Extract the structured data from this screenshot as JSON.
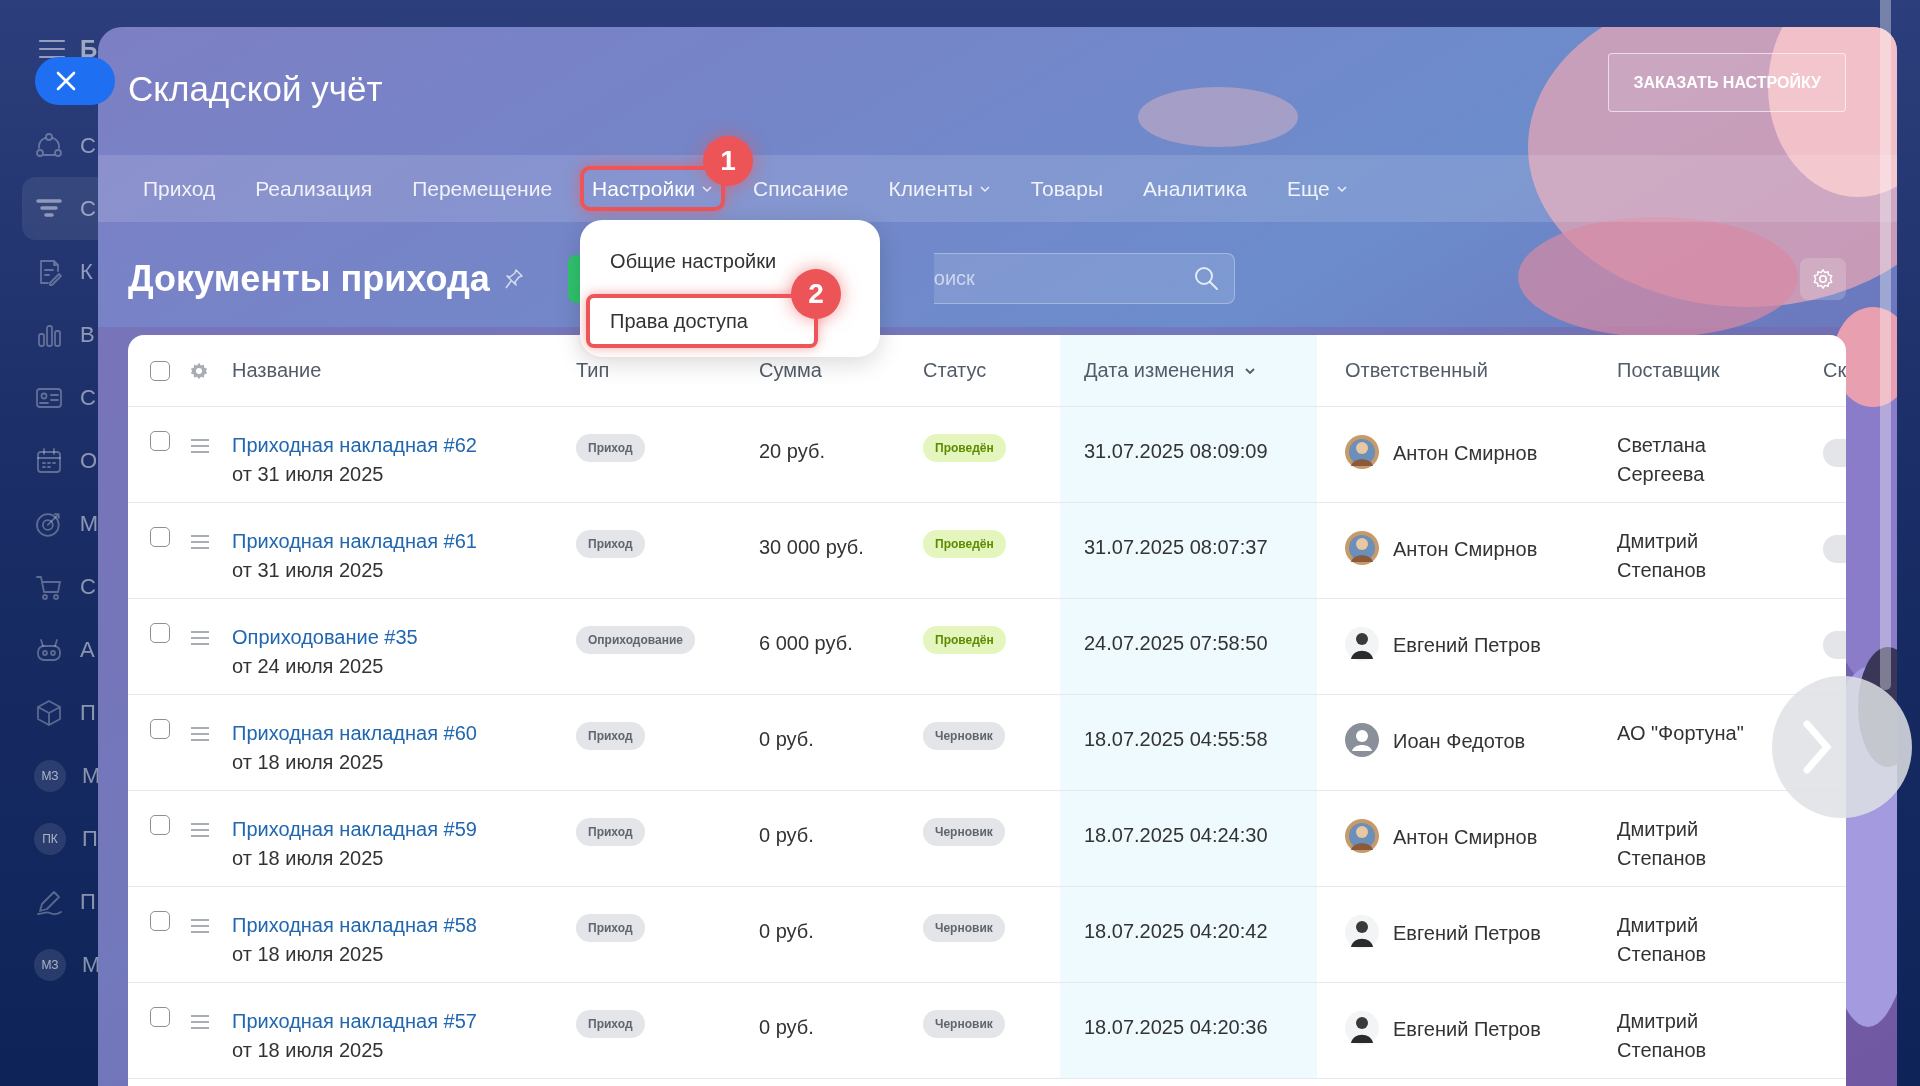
{
  "sidebar": {
    "title_letter": "Б",
    "items": [
      {
        "label": "С",
        "kind": "icon",
        "selected": false
      },
      {
        "label": "С",
        "kind": "icon",
        "selected": true
      },
      {
        "label": "К",
        "kind": "icon",
        "selected": false
      },
      {
        "label": "В",
        "kind": "icon",
        "selected": false
      },
      {
        "label": "С",
        "kind": "icon",
        "selected": false
      },
      {
        "label": "О",
        "kind": "icon",
        "selected": false
      },
      {
        "label": "М",
        "kind": "icon",
        "selected": false
      },
      {
        "label": "С",
        "kind": "icon",
        "selected": false
      },
      {
        "label": "А",
        "kind": "icon",
        "selected": false
      },
      {
        "label": "П",
        "kind": "icon",
        "selected": false
      },
      {
        "label": "М",
        "kind": "badge",
        "badge": "МЗ",
        "selected": false
      },
      {
        "label": "П",
        "kind": "badge",
        "badge": "ПК",
        "selected": false
      },
      {
        "label": "П",
        "kind": "icon",
        "selected": false
      },
      {
        "label": "М",
        "kind": "badge",
        "badge": "МЗ",
        "selected": false
      }
    ]
  },
  "panel": {
    "title": "Складской учёт",
    "order_button": "ЗАКАЗАТЬ НАСТРОЙКУ"
  },
  "tabs": [
    {
      "label": "Приход",
      "has_menu": false,
      "expanded": false
    },
    {
      "label": "Реализация",
      "has_menu": false,
      "expanded": false
    },
    {
      "label": "Перемещение",
      "has_menu": false,
      "expanded": false
    },
    {
      "label": "Настройки",
      "has_menu": true,
      "callout": "1",
      "expanded": true
    },
    {
      "label": "Списание",
      "has_menu": false,
      "expanded": false
    },
    {
      "label": "Клиенты",
      "has_menu": true,
      "expanded": false
    },
    {
      "label": "Товары",
      "has_menu": false,
      "expanded": false
    },
    {
      "label": "Аналитика",
      "has_menu": false,
      "expanded": false
    },
    {
      "label": "Еще",
      "has_menu": true,
      "expanded": false
    }
  ],
  "dropdown": {
    "items": [
      {
        "label": "Общие настройки"
      },
      {
        "label": "Права доступа",
        "callout": "2"
      }
    ]
  },
  "page": {
    "heading": "Документы прихода",
    "search": {
      "placeholder": "оиск"
    }
  },
  "table": {
    "all_checked": false,
    "columns": [
      {
        "label": "Название",
        "sorted": false
      },
      {
        "label": "Тип",
        "sorted": false
      },
      {
        "label": "Сумма",
        "sorted": false
      },
      {
        "label": "Статус",
        "sorted": false
      },
      {
        "label": "Дата изменения",
        "sorted": true
      },
      {
        "label": "Ответственный",
        "sorted": false
      },
      {
        "label": "Поставщик",
        "sorted": false
      },
      {
        "label": "Ск",
        "sorted": false
      }
    ],
    "rows": [
      {
        "checked": false,
        "title": "Приходная накладная #62",
        "date": "от 31 июля 2025",
        "type": "Приход",
        "sum": "20 руб.",
        "status": {
          "text": "Проведён",
          "kind": "posted"
        },
        "changed": "31.07.2025 08:09:09",
        "responsible": "Антон Смирнов",
        "supplier": "Светлана Сергеева",
        "extra_tag": true
      },
      {
        "checked": false,
        "title": "Приходная накладная #61",
        "date": "от 31 июля 2025",
        "type": "Приход",
        "sum": "30 000 руб.",
        "status": {
          "text": "Проведён",
          "kind": "posted"
        },
        "changed": "31.07.2025 08:07:37",
        "responsible": "Антон Смирнов",
        "supplier": "Дмитрий Степанов",
        "extra_tag": true
      },
      {
        "checked": false,
        "title": "Оприходование #35",
        "date": "от 24 июля 2025",
        "type": "Оприходование",
        "sum": "6 000 руб.",
        "status": {
          "text": "Проведён",
          "kind": "posted"
        },
        "changed": "24.07.2025 07:58:50",
        "responsible": "Евгений Петров",
        "avatar": {
          "kind": "man"
        },
        "extra_tag": true
      },
      {
        "checked": false,
        "title": "Приходная накладная #60",
        "date": "от 18 июля 2025",
        "type": "Приход",
        "sum": "0 руб.",
        "status": {
          "text": "Черновик",
          "kind": "draft"
        },
        "changed": "18.07.2025 04:55:58",
        "responsible": "Иоан Федотов",
        "avatar": {
          "kind": "default"
        },
        "supplier": "АО \"Фортуна\""
      },
      {
        "checked": false,
        "title": "Приходная накладная #59",
        "date": "от 18 июля 2025",
        "type": "Приход",
        "sum": "0 руб.",
        "status": {
          "text": "Черновик",
          "kind": "draft"
        },
        "changed": "18.07.2025 04:24:30",
        "responsible": "Антон Смирнов",
        "supplier": "Дмитрий Степанов",
        "extra_tag": false
      },
      {
        "checked": false,
        "title": "Приходная накладная #58",
        "date": "от 18 июля 2025",
        "type": "Приход",
        "sum": "0 руб.",
        "status": {
          "text": "Черновик",
          "kind": "draft"
        },
        "changed": "18.07.2025 04:20:42",
        "responsible": "Евгений Петров",
        "avatar": {
          "kind": "man"
        },
        "supplier": "Дмитрий Степанов",
        "extra_tag": false
      },
      {
        "checked": false,
        "title": "Приходная накладная #57",
        "date": "от 18 июля 2025",
        "type": "Приход",
        "sum": "0 руб.",
        "status": {
          "text": "Черновик",
          "kind": "draft"
        },
        "changed": "18.07.2025 04:20:36",
        "responsible": "Евгений Петров",
        "avatar": {
          "kind": "man"
        },
        "supplier": "Дмитрий Степанов",
        "extra_tag": false
      }
    ]
  }
}
